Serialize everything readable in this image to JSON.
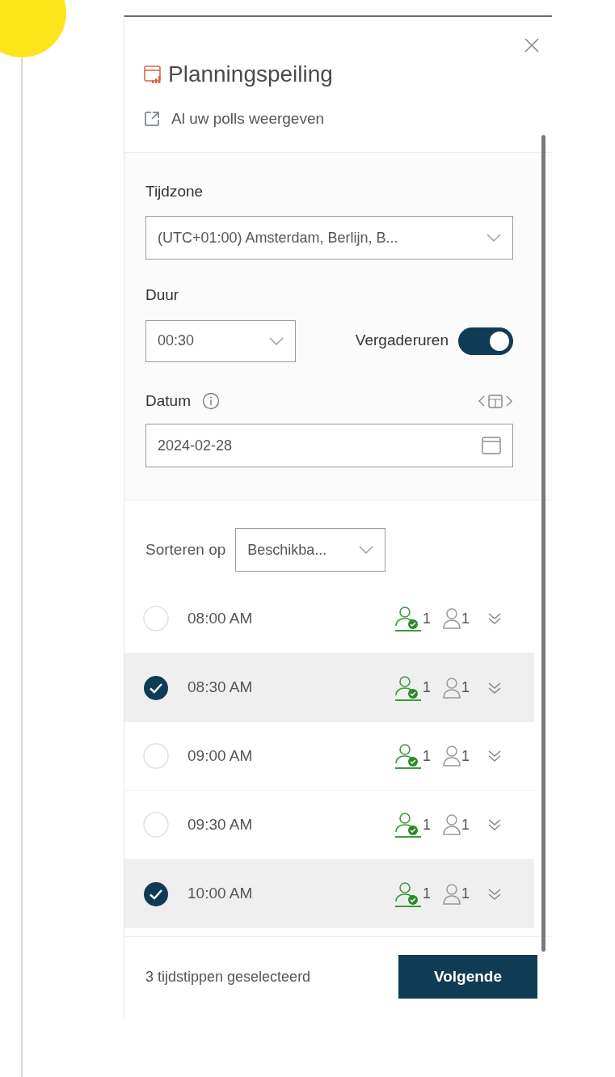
{
  "panel": {
    "title": "Planningspeiling",
    "view_all_link": "Al uw polls weergeven"
  },
  "timezone": {
    "label": "Tijdzone",
    "value": "(UTC+01:00) Amsterdam, Berlijn, B..."
  },
  "duration": {
    "label": "Duur",
    "value": "00:30"
  },
  "meeting_hours": {
    "label": "Vergaderuren",
    "on": true
  },
  "date": {
    "label": "Datum",
    "value": "2024-02-28"
  },
  "sort": {
    "label": "Sorteren op",
    "value": "Beschikba..."
  },
  "slots": [
    {
      "time": "08:00 AM",
      "selected": false,
      "available": "1",
      "attendees": "1"
    },
    {
      "time": "08:30 AM",
      "selected": true,
      "available": "1",
      "attendees": "1"
    },
    {
      "time": "09:00 AM",
      "selected": false,
      "available": "1",
      "attendees": "1"
    },
    {
      "time": "09:30 AM",
      "selected": false,
      "available": "1",
      "attendees": "1"
    },
    {
      "time": "10:00 AM",
      "selected": true,
      "available": "1",
      "attendees": "1"
    }
  ],
  "footer": {
    "status": "3 tijdstippen geselecteerd",
    "next_button": "Volgende"
  }
}
